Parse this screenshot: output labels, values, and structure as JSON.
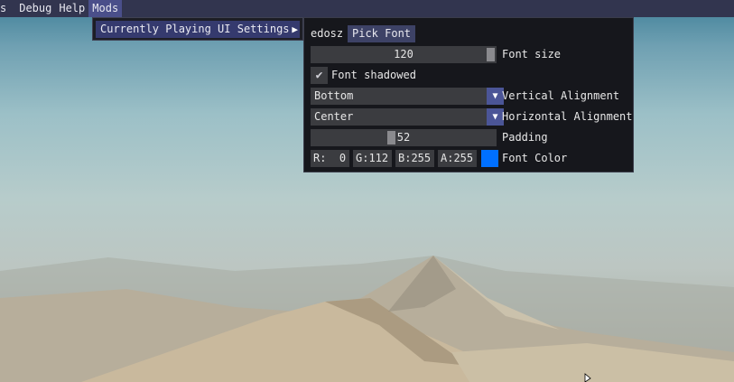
{
  "menubar": {
    "items": [
      {
        "label": "s"
      },
      {
        "label": "Debug"
      },
      {
        "label": "Help"
      },
      {
        "label": "Mods",
        "active": true
      }
    ]
  },
  "mods_menu": {
    "item_label": "Currently Playing UI Settings",
    "arrow": "▶"
  },
  "settings_panel": {
    "font_name": "edosz",
    "pick_font_label": "Pick Font",
    "font_size": {
      "value": "120",
      "label": "Font size",
      "position_fraction": 1.0
    },
    "font_shadowed": {
      "checked": true,
      "checkmark": "✔",
      "label": "Font shadowed"
    },
    "vertical_alignment": {
      "value": "Bottom",
      "label": "Vertical Alignment",
      "arrow": "▼"
    },
    "horizontal_alignment": {
      "value": "Center",
      "label": "Horizontal Alignment",
      "arrow": "▼"
    },
    "padding": {
      "value": "52",
      "label": "Padding",
      "position_fraction": 0.43
    },
    "font_color": {
      "r": "R:  0",
      "g": "G:112",
      "b": "B:255",
      "a": "A:255",
      "swatch": "#0070ff",
      "label": "Font Color"
    }
  },
  "colors": {
    "menubar_bg": "#32354f",
    "accent": "#4b5597",
    "panel_bg": "#16171c"
  }
}
